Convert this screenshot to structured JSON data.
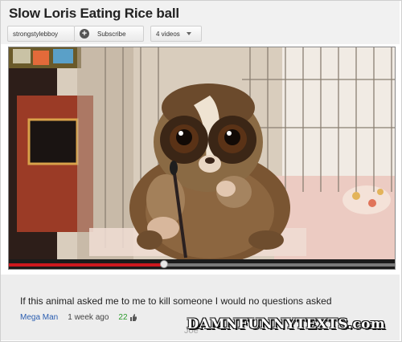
{
  "video": {
    "title": "Slow Loris Eating Rice ball",
    "channel_label": "strongstylebboy",
    "subscribe_label": "Subscribe",
    "videos_label": "4 videos",
    "progress_fraction": 0.4
  },
  "comment": {
    "text": "If this animal asked me to me to kill someone I would no questions asked",
    "author": "Mega Man",
    "time": "1 week ago",
    "likes": "22",
    "ghost_text": "Joe"
  },
  "watermark": "DAMNFUNNYTEXTS.com",
  "colors": {
    "progress": "#cc181e",
    "author_link": "#2a5db0",
    "likes": "#2a9a2a"
  }
}
